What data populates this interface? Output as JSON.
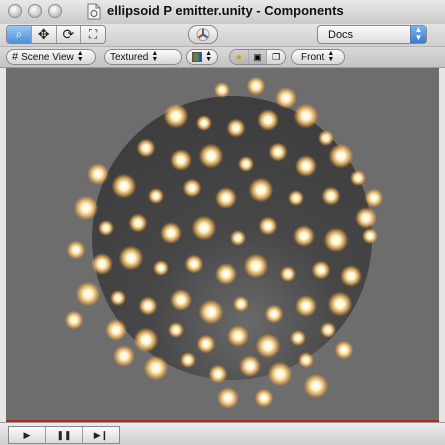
{
  "window": {
    "title": "ellipsoid P emitter.unity - Components"
  },
  "toolbar": {
    "tools": [
      {
        "name": "hand",
        "icon": "magnifier-icon",
        "glyph": "🔍",
        "active": true
      },
      {
        "name": "move",
        "icon": "move-icon",
        "glyph": "✥",
        "active": false
      },
      {
        "name": "rotate",
        "icon": "rotate-icon",
        "glyph": "⟳",
        "active": false
      },
      {
        "name": "scale",
        "icon": "scale-icon",
        "glyph": "⤧",
        "active": false
      }
    ],
    "layout_value": "Docs"
  },
  "viewbar": {
    "draw_mode": "Scene View",
    "render_mode": "Textured",
    "toggles": [
      {
        "icon": "lightbulb-icon",
        "glyph": "💡",
        "on": true
      },
      {
        "icon": "image-icon",
        "glyph": "▣",
        "on": true
      },
      {
        "icon": "cube-icon",
        "glyph": "❒",
        "on": false
      }
    ],
    "view_direction": "Front"
  },
  "colors": {
    "viewport_bg": "#6d6d6d",
    "sphere": "#4a4a4a",
    "particle_core": "#fffdf0",
    "particle_glow": "#ffb85a",
    "accent_red": "#b7221d"
  },
  "playback": {
    "buttons": [
      {
        "icon": "play-icon",
        "glyph": "▶"
      },
      {
        "icon": "pause-icon",
        "glyph": "❚❚"
      },
      {
        "icon": "step-icon",
        "glyph": "▶❙"
      }
    ]
  }
}
